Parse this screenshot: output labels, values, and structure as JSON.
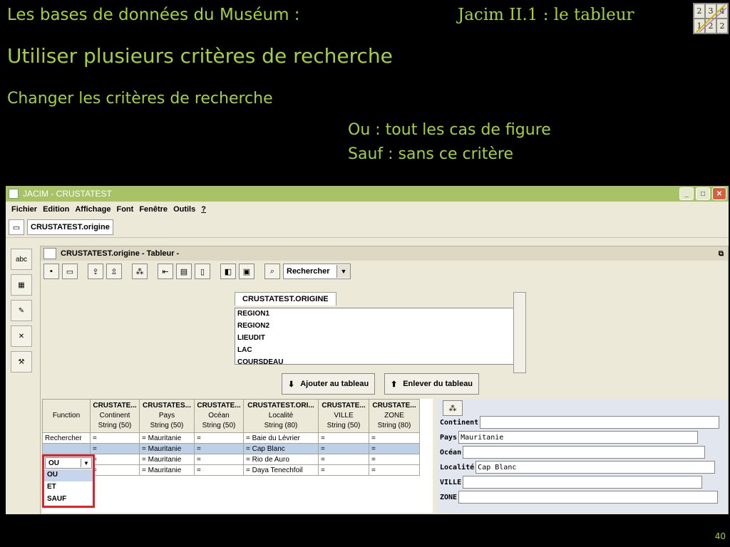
{
  "slide": {
    "header_left": "Les bases de données du Muséum :",
    "header_right": "Jacim II.1 : le tableur",
    "title": "Utiliser plusieurs critères de recherche",
    "subtitle": "Changer les critères de recherche",
    "note_ou": "Ou : tout les cas de figure",
    "note_sauf": "Sauf : sans ce critère",
    "page_number": "40",
    "logo_digits": [
      "2",
      "3",
      "4",
      "1",
      "2",
      "2"
    ]
  },
  "window": {
    "title": "JACIM - CRUSTATEST",
    "menu": [
      "Fichier",
      "Edition",
      "Affichage",
      "Font",
      "Fenêtre",
      "Outils"
    ],
    "help_label": "?",
    "tab_label": "CRUSTATEST.origine",
    "minimize": "_",
    "maximize": "□",
    "close": "✕"
  },
  "sidebar_icons": [
    "abc-icon",
    "table-icon",
    "edit-icon",
    "tools-icon",
    "wrench-icon"
  ],
  "inner": {
    "title": "CRUSTATEST.origine - Tableur -",
    "search_combo": "Rechercher",
    "field_tab": "CRUSTATEST.ORIGINE",
    "fields": [
      "REGION1",
      "REGION2",
      "LIEUDIT",
      "LAC",
      "COURSDEAU"
    ],
    "add_button": "Ajouter au tableau",
    "remove_button": "Enlever du tableau"
  },
  "grid": {
    "function_header": "Function",
    "columns": [
      {
        "name": "CRUSTATE...",
        "sub": "Continent",
        "type": "String (50)"
      },
      {
        "name": "CRUSTATES...",
        "sub": "Pays",
        "type": "String (50)"
      },
      {
        "name": "CRUSTATE...",
        "sub": "Océan",
        "type": "String (50)"
      },
      {
        "name": "CRUSTATEST.ORI...",
        "sub": "Localité",
        "type": "String (80)"
      },
      {
        "name": "CRUSTATE...",
        "sub": "VILLE",
        "type": "String (50)"
      },
      {
        "name": "CRUSTATE...",
        "sub": "ZONE",
        "type": "String (80)"
      }
    ],
    "rows": [
      {
        "fn": "Rechercher",
        "cells": [
          "=",
          "=  Mauritanie",
          "=",
          "=  Baie du Lévrier",
          "=",
          "="
        ]
      },
      {
        "fn": "",
        "cells": [
          "=",
          "=  Mauritanie",
          "=",
          "=  Cap Blanc",
          "=",
          "="
        ]
      },
      {
        "fn": "",
        "cells": [
          "=",
          "=  Mauritanie",
          "=",
          "=  Rio de Auro",
          "=",
          "="
        ]
      },
      {
        "fn": "",
        "cells": [
          "=",
          "=  Mauritanie",
          "=",
          "=  Daya Tenechfoil",
          "=",
          "="
        ]
      }
    ],
    "dropdown_value": "OU",
    "dropdown_options": [
      "OU",
      "ET",
      "SAUF"
    ]
  },
  "form": {
    "labels": [
      "Continent",
      "Pays",
      "Océan",
      "Localité",
      "VILLE",
      "ZONE"
    ],
    "values": [
      "",
      "Mauritanie",
      "",
      "Cap Blanc",
      "",
      ""
    ]
  }
}
